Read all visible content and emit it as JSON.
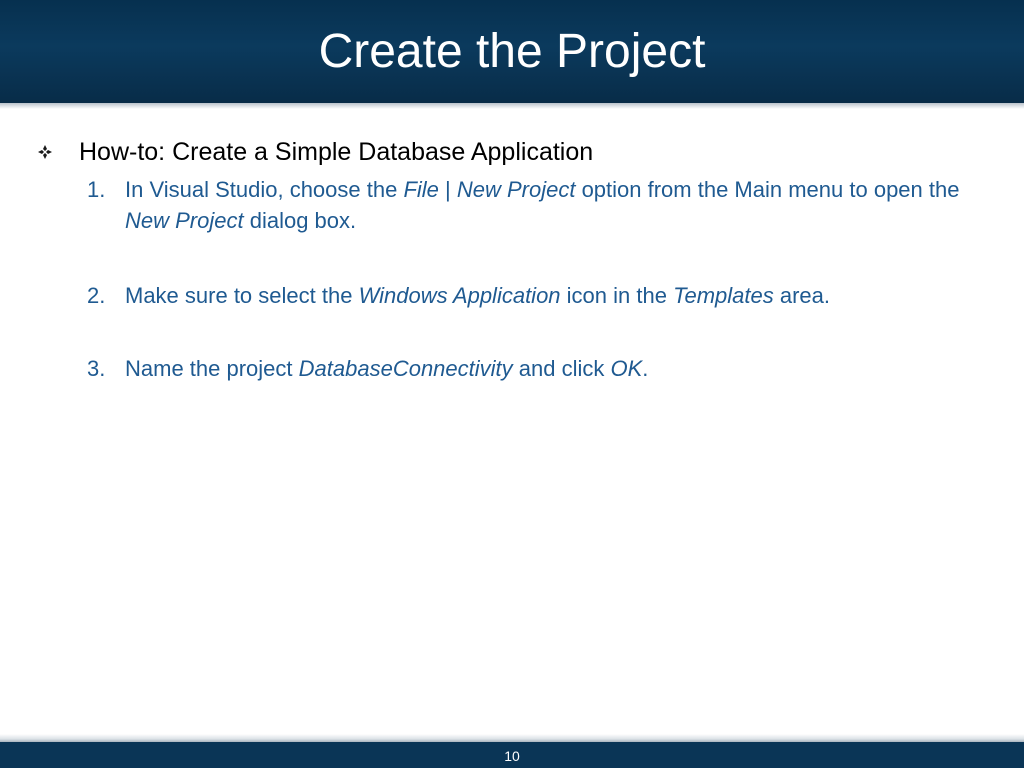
{
  "slide": {
    "title": "Create the Project",
    "heading": "How-to: Create a Simple Database Application",
    "bullet_icon": "diamond-four-petal-bullet",
    "text_color": "#1f5a91",
    "header_color": "#0b3a5d",
    "steps": [
      {
        "number": "1.",
        "parts": [
          {
            "text": "In Visual Studio, choose the ",
            "italic": false
          },
          {
            "text": "File",
            "italic": true
          },
          {
            "text": " | ",
            "italic": false
          },
          {
            "text": "New Project",
            "italic": true
          },
          {
            "text": " option from the Main menu to open the ",
            "italic": false
          },
          {
            "text": "New Project",
            "italic": true
          },
          {
            "text": " dialog box.",
            "italic": false
          }
        ]
      },
      {
        "number": "2.",
        "parts": [
          {
            "text": "Make sure to select the ",
            "italic": false
          },
          {
            "text": "Windows Application",
            "italic": true
          },
          {
            "text": " icon in the ",
            "italic": false
          },
          {
            "text": "Templates",
            "italic": true
          },
          {
            "text": " area.",
            "italic": false
          }
        ]
      },
      {
        "number": "3.",
        "parts": [
          {
            "text": "Name the project ",
            "italic": false
          },
          {
            "text": "DatabaseConnectivity",
            "italic": true
          },
          {
            "text": " and click ",
            "italic": false
          },
          {
            "text": "OK",
            "italic": true
          },
          {
            "text": ".",
            "italic": false
          }
        ]
      }
    ],
    "page_number": "10"
  }
}
